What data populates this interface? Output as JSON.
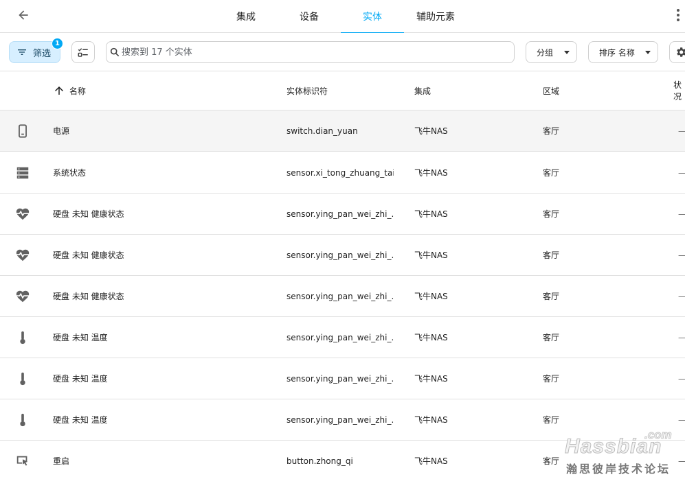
{
  "header": {
    "tabs": [
      {
        "label": "集成"
      },
      {
        "label": "设备"
      },
      {
        "label": "实体"
      },
      {
        "label": "辅助元素"
      }
    ],
    "active_tab": "实体"
  },
  "toolbar": {
    "filter_label": "筛选",
    "filter_badge": "1",
    "search_placeholder": "搜索到 17 个实体",
    "group_label": "分组",
    "sort_label": "排序 名称"
  },
  "table": {
    "columns": {
      "name": "名称",
      "entity_id": "实体标识符",
      "integration": "集成",
      "area": "区域",
      "status": "状况"
    },
    "rows": [
      {
        "icon": "cellphone-icon",
        "name": "电源",
        "entity_id": "switch.dian_yuan",
        "integration": "飞牛NAS",
        "area": "客厅",
        "status": "—"
      },
      {
        "icon": "server-icon",
        "name": "系统状态",
        "entity_id": "sensor.xi_tong_zhuang_tai",
        "integration": "飞牛NAS",
        "area": "客厅",
        "status": "—"
      },
      {
        "icon": "heart-pulse-icon",
        "name": "硬盘 未知 健康状态",
        "entity_id": "sensor.ying_pan_wei_zhi_...",
        "integration": "飞牛NAS",
        "area": "客厅",
        "status": "—"
      },
      {
        "icon": "heart-pulse-icon",
        "name": "硬盘 未知 健康状态",
        "entity_id": "sensor.ying_pan_wei_zhi_...",
        "integration": "飞牛NAS",
        "area": "客厅",
        "status": "—"
      },
      {
        "icon": "heart-pulse-icon",
        "name": "硬盘 未知 健康状态",
        "entity_id": "sensor.ying_pan_wei_zhi_...",
        "integration": "飞牛NAS",
        "area": "客厅",
        "status": "—"
      },
      {
        "icon": "thermometer-icon",
        "name": "硬盘 未知 温度",
        "entity_id": "sensor.ying_pan_wei_zhi_...",
        "integration": "飞牛NAS",
        "area": "客厅",
        "status": "—"
      },
      {
        "icon": "thermometer-icon",
        "name": "硬盘 未知 温度",
        "entity_id": "sensor.ying_pan_wei_zhi_...",
        "integration": "飞牛NAS",
        "area": "客厅",
        "status": "—"
      },
      {
        "icon": "thermometer-icon",
        "name": "硬盘 未知 温度",
        "entity_id": "sensor.ying_pan_wei_zhi_...",
        "integration": "飞牛NAS",
        "area": "客厅",
        "status": "—"
      },
      {
        "icon": "gesture-tap-button-icon",
        "name": "重启",
        "entity_id": "button.zhong_qi",
        "integration": "飞牛NAS",
        "area": "客厅",
        "status": "—"
      }
    ]
  },
  "watermark": {
    "com": ".com",
    "brand": "Hassbian",
    "subtitle": "瀚思彼岸技术论坛"
  },
  "colors": {
    "accent": "#03a9f4",
    "filter_bg": "#d7efff",
    "row_highlight": "#f5f5f5",
    "icon_gray": "#616161"
  }
}
